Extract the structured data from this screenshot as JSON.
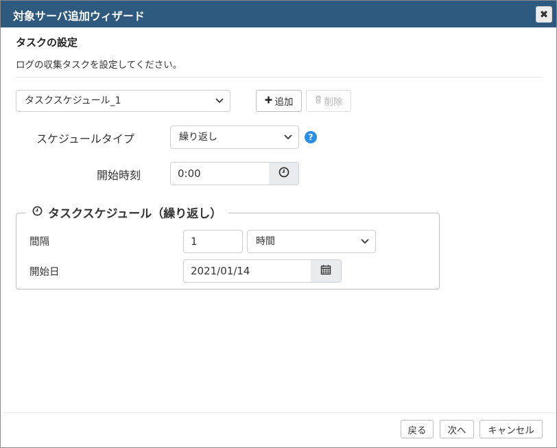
{
  "window": {
    "title": "対象サーバ追加ウィザード",
    "close_symbol": "✖"
  },
  "section": {
    "title": "タスクの設定",
    "description": "ログの収集タスクを設定してください。"
  },
  "schedule_select": {
    "selected": "タスクスケジュール_1"
  },
  "toolbar": {
    "add_label": "追加",
    "delete_label": "削除"
  },
  "form": {
    "schedule_type_label": "スケジュールタイプ",
    "schedule_type_value": "繰り返し",
    "start_time_label": "開始時刻",
    "start_time_value": "0:00",
    "help_symbol": "?"
  },
  "repeat_group": {
    "legend": "タスクスケジュール（繰り返し）",
    "interval_label": "間隔",
    "interval_value": "1",
    "interval_unit": "時間",
    "start_date_label": "開始日",
    "start_date_value": "2021/01/14"
  },
  "footer": {
    "back_label": "戻る",
    "next_label": "次へ",
    "cancel_label": "キャンセル"
  },
  "colors": {
    "titlebar": "#2f5a7f",
    "help": "#2c8fe6"
  }
}
